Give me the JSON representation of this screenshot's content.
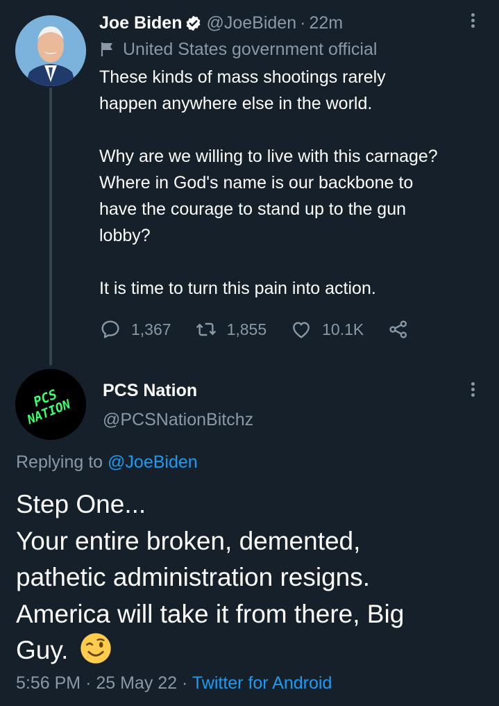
{
  "original": {
    "name": "Joe Biden",
    "handle": "@JoeBiden",
    "separator": "·",
    "time": "22m",
    "label": "United States government official",
    "text_lines": [
      "These kinds of mass shootings rarely",
      "happen anywhere else in the world.",
      "",
      "Why are we willing to live with this carnage?",
      "Where in God's name is our backbone to",
      "have the courage to stand up to the gun",
      "lobby?",
      "",
      "It is time to turn this pain into action."
    ],
    "replies_count": "1,367",
    "retweets_count": "1,855",
    "likes_count": "10.1K"
  },
  "reply": {
    "name": "PCS Nation",
    "handle": "@PCSNationBitchz",
    "avatar_text_1": "PCS",
    "avatar_text_2": "NATION",
    "replying_prefix": "Replying to",
    "replying_to": "@JoeBiden",
    "text_lines": [
      "Step One...",
      "Your entire broken, demented,",
      "pathetic administration resigns.",
      "America will take it from there, Big",
      "Guy."
    ],
    "emoji": "winking-face-emoji",
    "time": "5:56 PM",
    "separator": "·",
    "date": "25 May 22",
    "client": "Twitter for Android"
  },
  "colors": {
    "background": "#15202b",
    "text": "#ffffff",
    "muted": "#8b98a5",
    "link": "#1d9bf0",
    "avatar_green": "#3cff6a"
  }
}
